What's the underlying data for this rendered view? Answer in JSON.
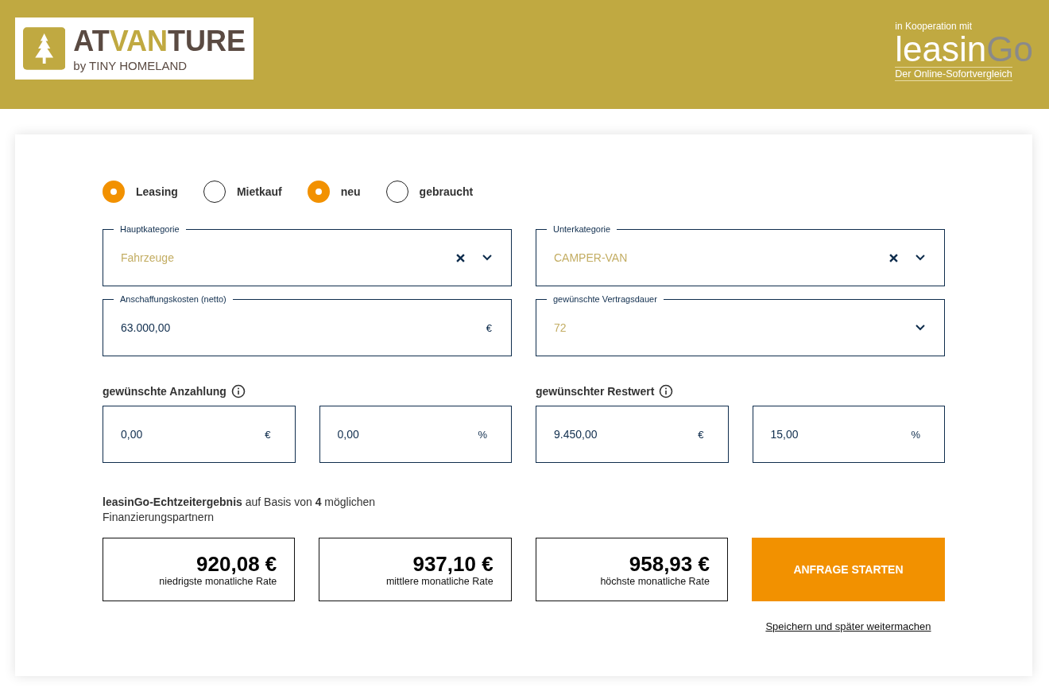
{
  "header": {
    "logo": {
      "parts": [
        {
          "text": "AT",
          "color": "#5a4a42"
        },
        {
          "text": "VAN",
          "color": "#c0a941"
        },
        {
          "text": "TURE",
          "color": "#5a4a42"
        }
      ],
      "tagline": "by TINY HOMELAND"
    },
    "partner": {
      "intro": "in Kooperation mit",
      "name_parts": [
        {
          "text": "leasin",
          "color": "#ffffff"
        },
        {
          "text": "Go",
          "color": "#8a8a8a"
        }
      ],
      "tagline": "Der Online-Sofortvergleich"
    }
  },
  "radios": [
    {
      "label": "Leasing",
      "selected": true
    },
    {
      "label": "Mietkauf",
      "selected": false
    },
    {
      "label": "neu",
      "selected": true
    },
    {
      "label": "gebraucht",
      "selected": false
    }
  ],
  "fields": [
    {
      "kind": "select",
      "label": "Hauptkategorie",
      "value": "Fahrzeuge",
      "clearable": true
    },
    {
      "kind": "select",
      "label": "Unterkategorie",
      "value": "CAMPER-VAN",
      "clearable": true
    },
    {
      "kind": "amount",
      "label": "Anschaffungskosten (netto)",
      "value": "63.000,00",
      "unit": "€"
    },
    {
      "kind": "select",
      "label": "gewünschte Vertragsdauer",
      "value": "72",
      "clearable": false
    }
  ],
  "groups": [
    {
      "title": "gewünschte Anzahlung",
      "inputs": [
        {
          "value": "0,00",
          "unit": "€"
        },
        {
          "value": "0,00",
          "unit": "%"
        }
      ]
    },
    {
      "title": "gewünschter Restwert",
      "inputs": [
        {
          "value": "9.450,00",
          "unit": "€"
        },
        {
          "value": "15,00",
          "unit": "%"
        }
      ]
    }
  ],
  "result_note": "**leasinGo-Echtzeitergebnis** auf Basis von **4** möglichen Finanzierungspartnern",
  "rates": [
    {
      "amount": "920,08 €",
      "label": "niedrigste monatliche Rate"
    },
    {
      "amount": "937,10 €",
      "label": "mittlere monatliche Rate"
    },
    {
      "amount": "958,93 €",
      "label": "höchste monatliche Rate"
    }
  ],
  "submit": "ANFRAGE STARTEN",
  "save_link": "Speichern und später weitermachen"
}
